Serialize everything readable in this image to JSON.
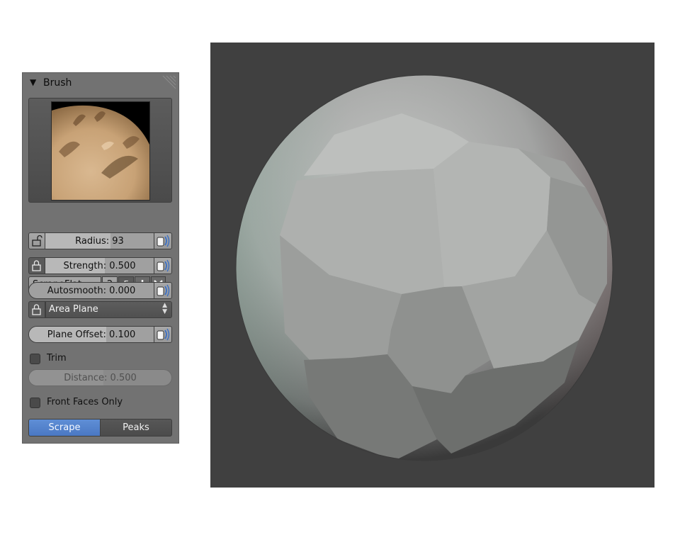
{
  "panel": {
    "header": {
      "title": "Brush",
      "toggle_icon": "triangle-down-icon"
    },
    "brush": {
      "name": "ScrapeFlat",
      "users": "2",
      "fake_user": "F"
    },
    "radius": {
      "label": "Radius: 93",
      "value": 93
    },
    "strength": {
      "label": "Strength: 0.500",
      "value": 0.5
    },
    "autosmooth": {
      "label": "Autosmooth: 0.000",
      "value": 0.0
    },
    "area_plane": {
      "selected": "Area Plane"
    },
    "plane_offset": {
      "label": "Plane Offset: 0.100",
      "value": 0.1
    },
    "trim": {
      "label": "Trim",
      "checked": false
    },
    "distance": {
      "label": "Distance: 0.500",
      "value": 0.5
    },
    "front_faces_only": {
      "label": "Front Faces Only",
      "checked": false
    },
    "mode_tabs": [
      {
        "label": "Scrape",
        "active": true
      },
      {
        "label": "Peaks",
        "active": false
      }
    ]
  },
  "colors": {
    "panel_bg": "#727272",
    "active_tab": "#5680cc",
    "viewport_bg": "#404040"
  }
}
